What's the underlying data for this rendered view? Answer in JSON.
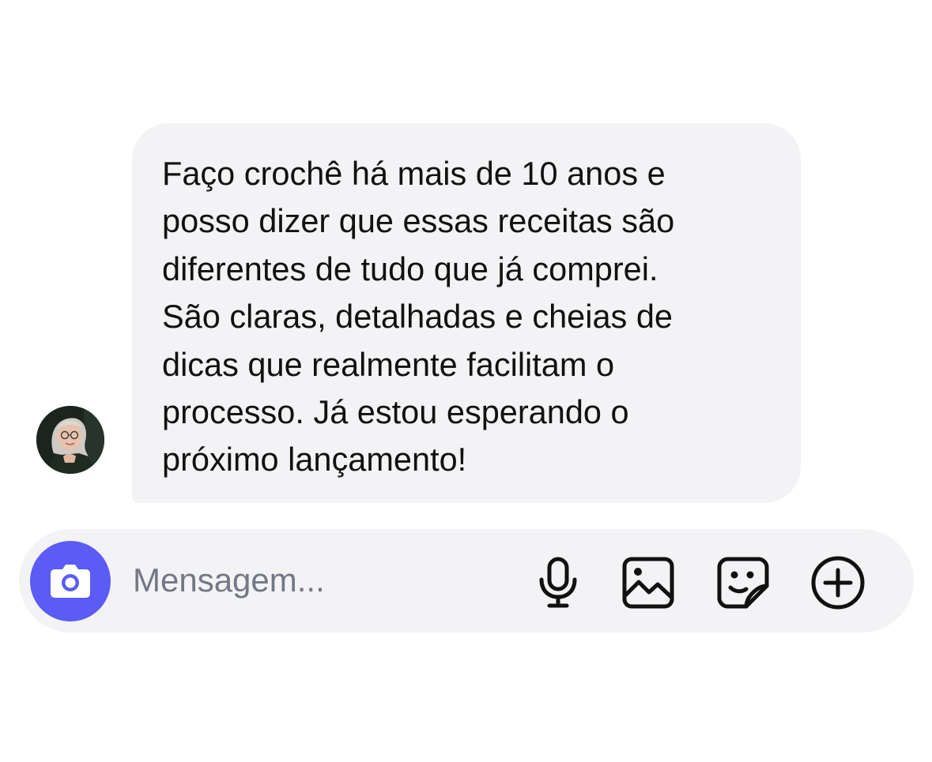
{
  "conversation": {
    "message": {
      "lines": [
        "Faço crochê há mais de 10 anos e",
        "posso dizer que essas receitas são",
        "diferentes de tudo que já comprei.",
        "São claras, detalhadas e cheias de",
        "dicas que realmente facilitam o",
        "processo. Já estou esperando o",
        "próximo lançamento!"
      ]
    }
  },
  "composer": {
    "placeholder": "Mensagem...",
    "buttons": {
      "camera": {
        "icon": "camera-icon"
      },
      "microphone": {
        "icon": "microphone-icon"
      },
      "gallery": {
        "icon": "image-icon"
      },
      "sticker": {
        "icon": "sticker-icon"
      },
      "more": {
        "icon": "plus-circle-icon"
      }
    }
  },
  "colors": {
    "accent": "#5b5bf5",
    "bubble_background": "#f3f3f5",
    "composer_background": "#f3f3f5",
    "text": "#111111",
    "placeholder_text": "#727886"
  }
}
